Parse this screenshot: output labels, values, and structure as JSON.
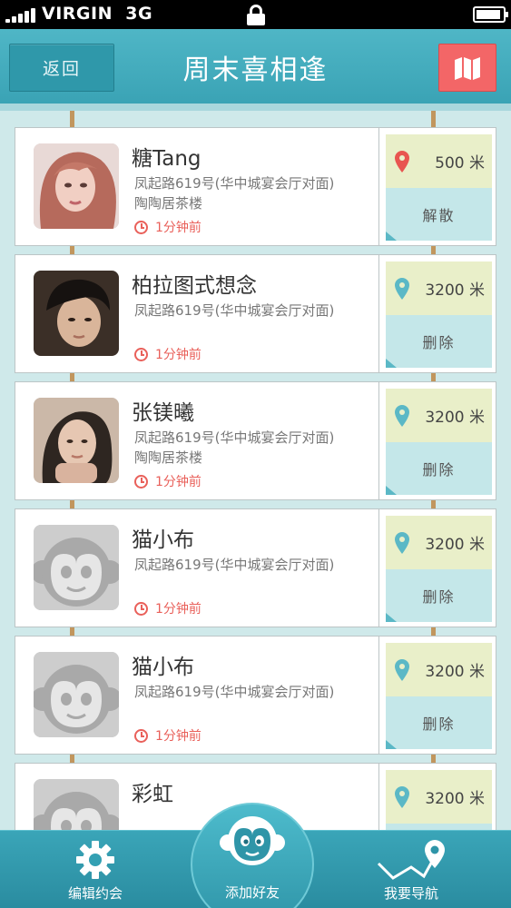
{
  "status_bar": {
    "carrier": "VIRGIN",
    "network": "3G"
  },
  "header": {
    "back_label": "返回",
    "title": "周末喜相逢",
    "map_icon": "map-icon"
  },
  "contacts": [
    {
      "name": "糖Tang",
      "address": "凤起路619号(华中城宴会厅对面)",
      "place": "陶陶居茶楼",
      "time": "1分钟前",
      "distance": "500 米",
      "action": "解散",
      "pin_color": "#e85550",
      "avatar": "photo-woman-pink-hair"
    },
    {
      "name": "柏拉图式想念",
      "address": "凤起路619号(华中城宴会厅对面)",
      "place": "",
      "time": "1分钟前",
      "distance": "3200 米",
      "action": "删除",
      "pin_color": "#5bb8c6",
      "avatar": "photo-man-dark-hair"
    },
    {
      "name": "张镁曦",
      "address": "凤起路619号(华中城宴会厅对面)",
      "place": "陶陶居茶楼",
      "time": "1分钟前",
      "distance": "3200 米",
      "action": "删除",
      "pin_color": "#5bb8c6",
      "avatar": "photo-woman-dark-hair"
    },
    {
      "name": "猫小布",
      "address": "凤起路619号(华中城宴会厅对面)",
      "place": "",
      "time": "1分钟前",
      "distance": "3200 米",
      "action": "删除",
      "pin_color": "#5bb8c6",
      "avatar": "monkey-placeholder"
    },
    {
      "name": "猫小布",
      "address": "凤起路619号(华中城宴会厅对面)",
      "place": "",
      "time": "1分钟前",
      "distance": "3200 米",
      "action": "删除",
      "pin_color": "#5bb8c6",
      "avatar": "monkey-placeholder"
    },
    {
      "name": "彩虹",
      "address": "",
      "place": "",
      "time": "",
      "distance": "3200 米",
      "action": "",
      "pin_color": "#5bb8c6",
      "avatar": "monkey-placeholder"
    }
  ],
  "tabs": [
    {
      "label": "编辑约会",
      "icon": "gear-icon"
    },
    {
      "label": "添加好友",
      "icon": "monkey-icon"
    },
    {
      "label": "我要导航",
      "icon": "route-pin-icon"
    }
  ],
  "colors": {
    "primary": "#3aa3b5",
    "accent_red": "#f36667",
    "time_red": "#e9605a",
    "distance_bg": "#e9efc9",
    "action_bg": "#c4e7e9"
  }
}
